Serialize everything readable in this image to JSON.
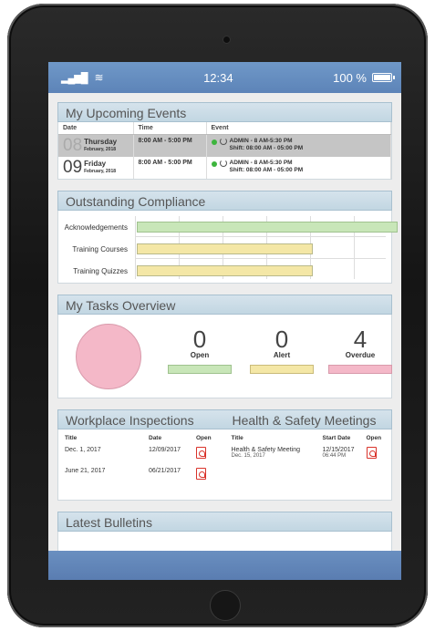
{
  "status": {
    "time": "12:34",
    "battery": "100 %"
  },
  "events": {
    "title": "My Upcoming Events",
    "headers": [
      "Date",
      "Time",
      "Event"
    ],
    "rows": [
      {
        "day": "08",
        "dayname": "Thursday",
        "month": "February, 2018",
        "time": "8:00 AM - 5:00 PM",
        "event1": "ADMIN - 8 AM-5:30 PM",
        "event2": "Shift: 08:00 AM - 05:00 PM"
      },
      {
        "day": "09",
        "dayname": "Friday",
        "month": "February, 2018",
        "time": "8:00 AM - 5:00 PM",
        "event1": "ADMIN - 8 AM-5:30 PM",
        "event2": "Shift: 08:00 AM - 05:00 PM"
      }
    ]
  },
  "compliance": {
    "title": "Outstanding Compliance",
    "rows": [
      {
        "label": "Acknowledgements",
        "color": "#c8e6b8"
      },
      {
        "label": "Training Courses",
        "color": "#f4e7a6"
      },
      {
        "label": "Training Quizzes",
        "color": "#f4e7a6"
      }
    ]
  },
  "tasks": {
    "title": "My Tasks Overview",
    "items": [
      {
        "count": "0",
        "label": "Open",
        "color": "#c8e6b8"
      },
      {
        "count": "0",
        "label": "Alert",
        "color": "#f4e7a6"
      },
      {
        "count": "4",
        "label": "Overdue",
        "color": "#f4b8c8"
      }
    ]
  },
  "inspections": {
    "title": "Workplace Inspections",
    "headers": [
      "Title",
      "Date",
      "Open"
    ],
    "rows": [
      {
        "title": "Dec. 1, 2017",
        "date": "12/09/2017"
      },
      {
        "title": "June 21, 2017",
        "date": "06/21/2017"
      }
    ]
  },
  "meetings": {
    "title": "Health & Safety Meetings",
    "headers": [
      "Title",
      "Start Date",
      "Open"
    ],
    "rows": [
      {
        "title": "Health & Safety Meeting",
        "subtitle": "Dec. 15, 2017",
        "date": "12/15/2017",
        "time": "06:44 PM"
      }
    ]
  },
  "bulletins": {
    "title": "Latest Bulletins"
  }
}
